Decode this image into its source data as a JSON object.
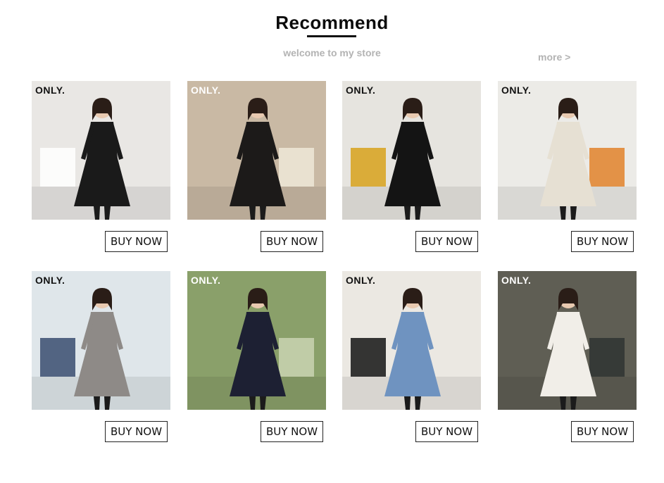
{
  "section": {
    "title": "Recommend",
    "subtitle": "welcome to my store",
    "more_label": "more >"
  },
  "products": [
    {
      "brand": "ONLY.",
      "button": "BUY NOW",
      "bg": "#e9e7e4",
      "outfit": "#1a1a1a",
      "accent": "#ffffff"
    },
    {
      "brand": "ONLY.",
      "button": "BUY NOW",
      "bg": "#c9b9a4",
      "outfit": "#1c1a19",
      "accent": "#eee7d8"
    },
    {
      "brand": "ONLY.",
      "button": "BUY NOW",
      "bg": "#e6e4df",
      "outfit": "#141414",
      "accent": "#d7a21c"
    },
    {
      "brand": "ONLY.",
      "button": "BUY NOW",
      "bg": "#ecebe7",
      "outfit": "#e6e0d3",
      "accent": "#e2832a"
    },
    {
      "brand": "ONLY.",
      "button": "BUY NOW",
      "bg": "#dfe6ea",
      "outfit": "#8e8a87",
      "accent": "#3a4c70"
    },
    {
      "brand": "ONLY.",
      "button": "BUY NOW",
      "bg": "#8aa06a",
      "outfit": "#1d2033",
      "accent": "#c9d4b1"
    },
    {
      "brand": "ONLY.",
      "button": "BUY NOW",
      "bg": "#ebe8e2",
      "outfit": "#6f93c0",
      "accent": "#141414"
    },
    {
      "brand": "ONLY.",
      "button": "BUY NOW",
      "bg": "#5f5e54",
      "outfit": "#f1eee8",
      "accent": "#2f3433"
    }
  ]
}
